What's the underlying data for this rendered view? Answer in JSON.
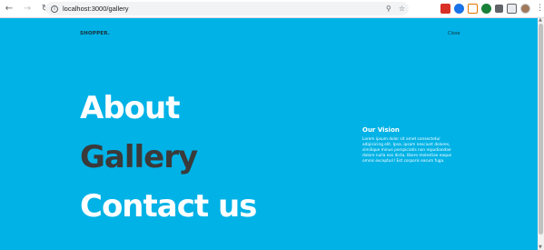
{
  "browser": {
    "url_host": "localhost",
    "url_rest": ":3000/gallery",
    "back_icon": "arrow-left-icon",
    "forward_icon": "arrow-right-icon",
    "reload_icon": "reload-icon"
  },
  "site": {
    "brand": "SHOPPER.",
    "close_label": "Close",
    "menu": [
      {
        "label": "About",
        "active": false
      },
      {
        "label": "Gallery",
        "active": true
      },
      {
        "label": "Contact us",
        "active": false
      }
    ],
    "vision": {
      "title": "Our Vision",
      "body": "Lorem ipsum dolor sit amet consectetur adipisicing elit. Ipsa, ipsam nesciunt dolores, similique minus perspiciatis non repudiandae dolore nulla eos dicta, libero molestiae eaque omnis excepturi! Est corporis earum fuga."
    }
  },
  "colors": {
    "page_background": "#00b2e6",
    "active_menu": "#3a3a3a",
    "menu_text": "#ffffff"
  }
}
